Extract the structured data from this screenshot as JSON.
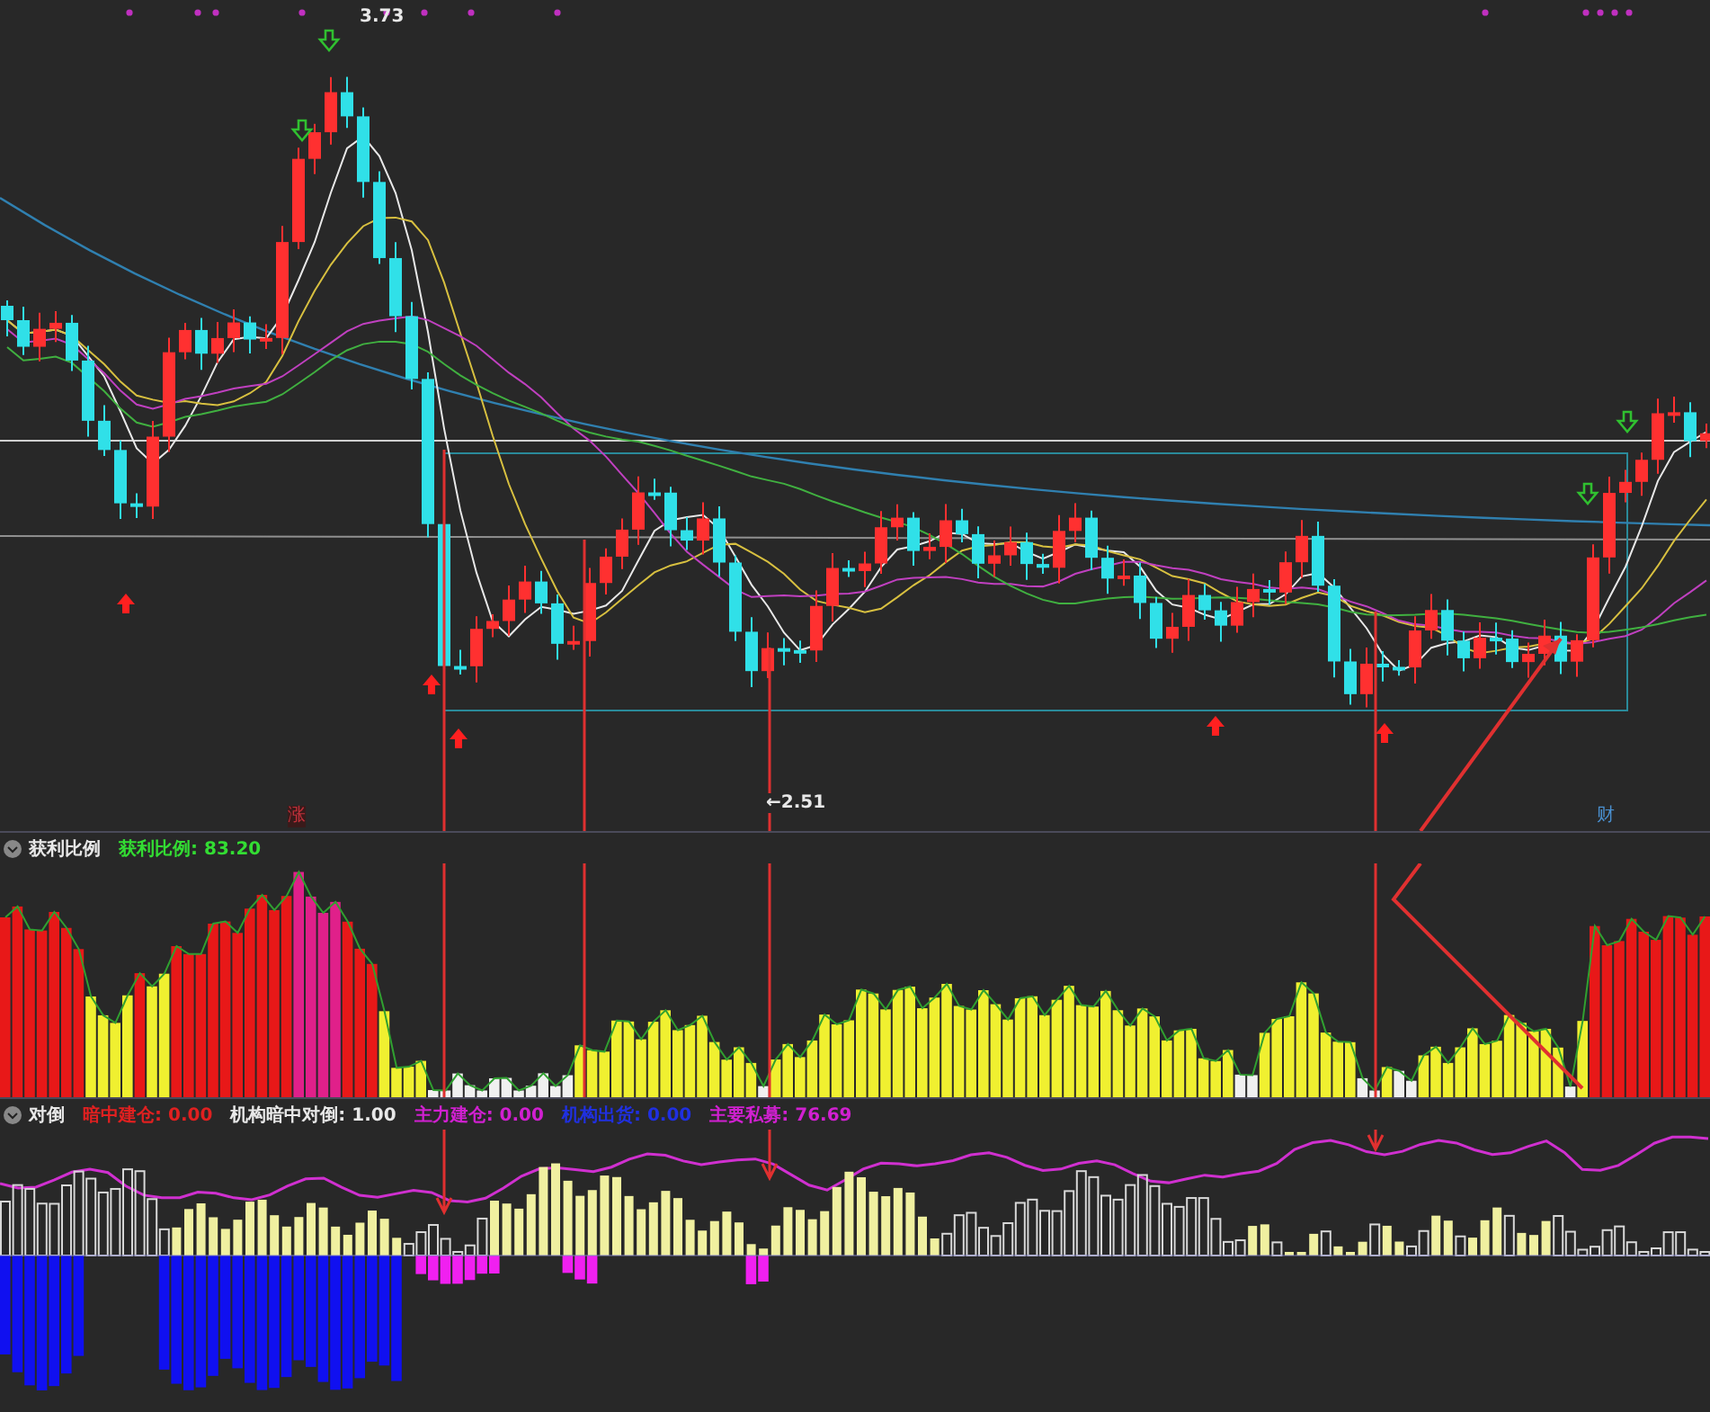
{
  "main_chart": {
    "high_label": "3.73",
    "low_label": "←2.51",
    "markers": [
      {
        "text": "涨",
        "color": "#c0303a"
      },
      {
        "text": "财",
        "color": "#4a90d0"
      }
    ]
  },
  "indicator_1": {
    "title": "获利比例",
    "readings": [
      {
        "text": "获利比例: 83.20",
        "color": "#33dd33"
      }
    ]
  },
  "indicator_2": {
    "title": "对倒",
    "readings": [
      {
        "text": "暗中建仓: 0.00",
        "color": "#e02020"
      },
      {
        "text": "机构暗中对倒: 1.00",
        "color": "#e8e8e8"
      },
      {
        "text": "主力建仓: 0.00",
        "color": "#d020d0"
      },
      {
        "text": "机构出货: 0.00",
        "color": "#2030e0"
      },
      {
        "text": "主要私募: 76.69",
        "color": "#d020d0"
      }
    ]
  }
}
